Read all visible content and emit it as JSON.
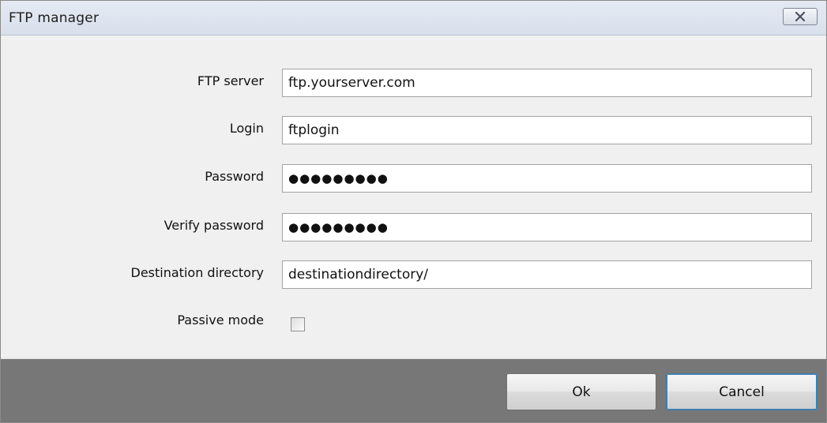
{
  "window": {
    "title": "FTP manager",
    "close_icon": "close-x-icon"
  },
  "form": {
    "ftp_server": {
      "label": "FTP server",
      "value": "ftp.yourserver.com"
    },
    "login": {
      "label": "Login",
      "value": "ftplogin"
    },
    "password": {
      "label": "Password",
      "value": "●●●●●●●●●"
    },
    "verify_password": {
      "label": "Verify password",
      "value": "●●●●●●●●●"
    },
    "destination_directory": {
      "label": "Destination directory",
      "value": "destinationdirectory/"
    },
    "passive_mode": {
      "label": "Passive mode",
      "checked": false
    }
  },
  "buttons": {
    "ok_label": "Ok",
    "cancel_label": "Cancel"
  }
}
